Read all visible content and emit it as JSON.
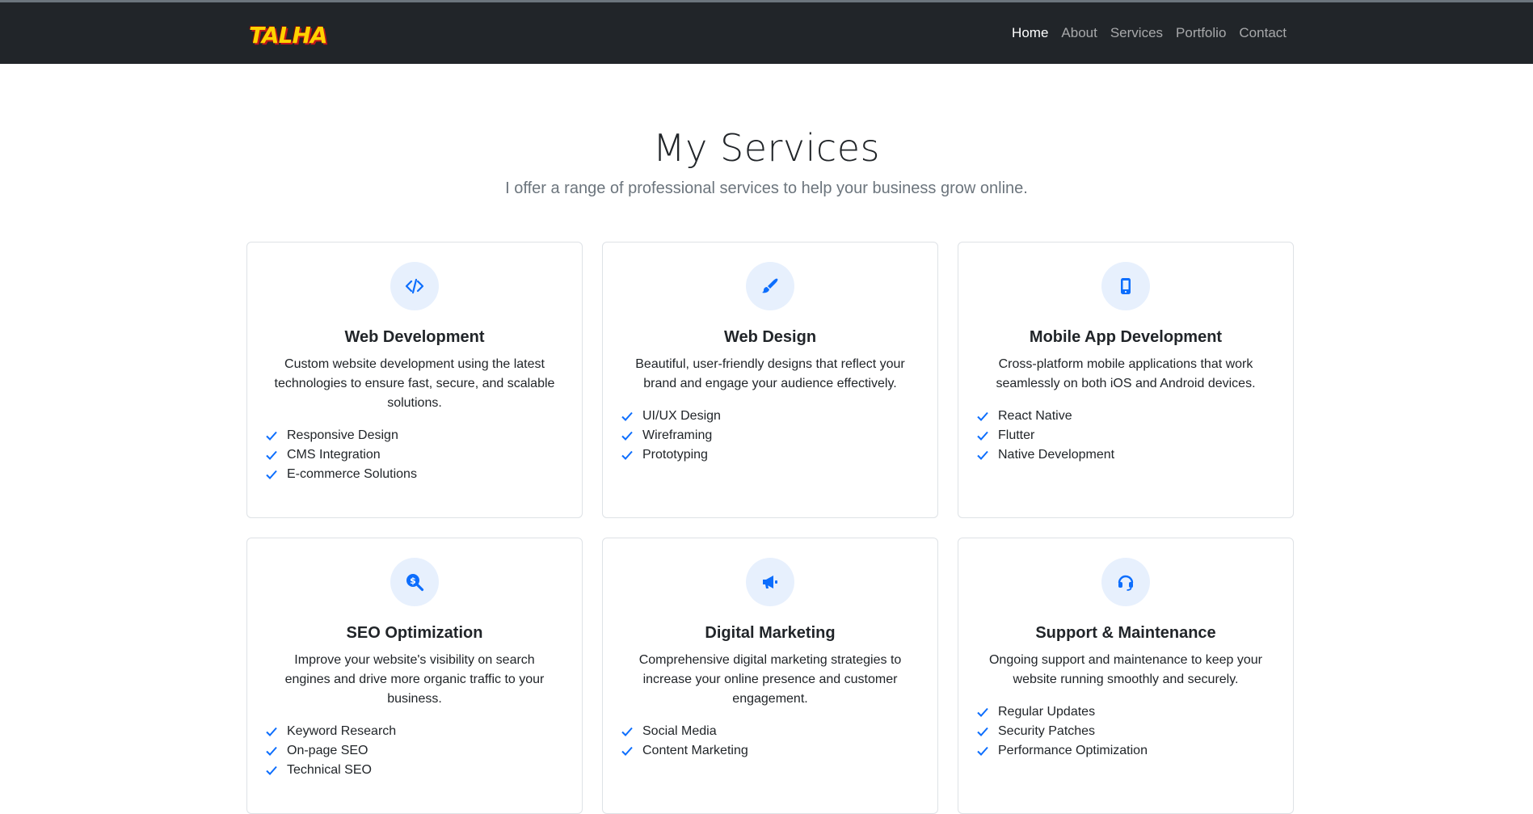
{
  "nav": {
    "logo": "TALHA",
    "links": [
      "Home",
      "About",
      "Services",
      "Portfolio",
      "Contact"
    ],
    "active": "Home"
  },
  "header": {
    "title": "My Services",
    "subtitle": "I offer a range of professional services to help your business grow online."
  },
  "colors": {
    "accent": "#0d6efd",
    "icon_bg": "#e7f0fd",
    "navbar_bg": "#212529"
  },
  "services": [
    {
      "icon": "code-icon",
      "title": "Web Development",
      "description": "Custom website development using the latest technologies to ensure fast, secure, and scalable solutions.",
      "features": [
        "Responsive Design",
        "CMS Integration",
        "E-commerce Solutions"
      ]
    },
    {
      "icon": "paintbrush-icon",
      "title": "Web Design",
      "description": "Beautiful, user-friendly designs that reflect your brand and engage your audience effectively.",
      "features": [
        "UI/UX Design",
        "Wireframing",
        "Prototyping"
      ]
    },
    {
      "icon": "mobile-phone-icon",
      "title": "Mobile App Development",
      "description": "Cross-platform mobile applications that work seamlessly on both iOS and Android devices.",
      "features": [
        "React Native",
        "Flutter",
        "Native Development"
      ]
    },
    {
      "icon": "search-dollar-icon",
      "title": "SEO Optimization",
      "description": "Improve your website's visibility on search engines and drive more organic traffic to your business.",
      "features": [
        "Keyword Research",
        "On-page SEO",
        "Technical SEO"
      ]
    },
    {
      "icon": "megaphone-icon",
      "title": "Digital Marketing",
      "description": "Comprehensive digital marketing strategies to increase your online presence and customer engagement.",
      "features": [
        "Social Media",
        "Content Marketing"
      ]
    },
    {
      "icon": "headset-icon",
      "title": "Support & Maintenance",
      "description": "Ongoing support and maintenance to keep your website running smoothly and securely.",
      "features": [
        "Regular Updates",
        "Security Patches",
        "Performance Optimization"
      ]
    }
  ]
}
